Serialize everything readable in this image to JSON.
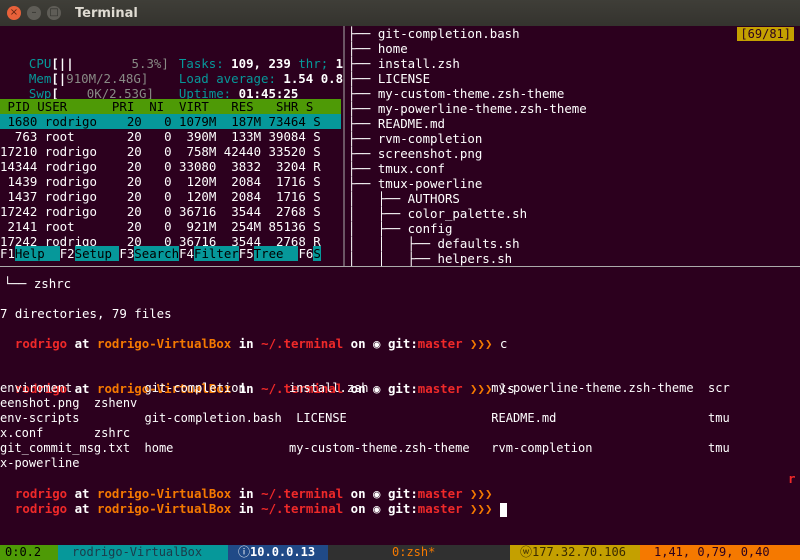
{
  "window": {
    "title": "Terminal",
    "close": "×",
    "minimize": "–",
    "maximize": "□"
  },
  "htop": {
    "cpu_label": "CPU",
    "cpu_bar": "[||",
    "cpu_value": "5.3%]",
    "mem_label": "Mem",
    "mem_bar": "[|",
    "mem_value": "910M/2.48G]",
    "swp_label": "Swp",
    "swp_bar": "[",
    "swp_value": "0K/2.53G]",
    "tasks_label": "Tasks:",
    "tasks_value": "109,",
    "thr_value": "239",
    "thr_label": "thr;",
    "running": "1",
    "load_label": "Load average:",
    "load1": "1.54",
    "load5": "0.8",
    "uptime_label": "Uptime:",
    "uptime_value": "01:45:25",
    "header": " PID USER      PRI  NI  VIRT   RES   SHR S",
    "rows": [
      " 1680 rodrigo    20   0 1079M  187M 73464 S",
      "  763 root       20   0  390M  133M 39084 S",
      "17210 rodrigo    20   0  758M 42440 33520 S",
      "14344 rodrigo    20   0 33080  3832  3204 R",
      " 1439 rodrigo    20   0  120M  2084  1716 S",
      " 1437 rodrigo    20   0  120M  2084  1716 S",
      "17242 rodrigo    20   0 36716  3544  2768 S",
      " 2141 root       20   0  921M  254M 85136 S",
      "17242 rodrigo    20   0 36716  3544  2768 R"
    ],
    "fkeys": [
      {
        "key": "F1",
        "label": "Help  "
      },
      {
        "key": "F2",
        "label": "Setup "
      },
      {
        "key": "F3",
        "label": "Search"
      },
      {
        "key": "F4",
        "label": "Filter"
      },
      {
        "key": "F5",
        "label": "Tree  "
      },
      {
        "key": "F6",
        "label": "S"
      }
    ]
  },
  "tree": {
    "counter": "[69/81]",
    "items": [
      "├── git-completion.bash",
      "├── home",
      "├── install.zsh",
      "├── LICENSE",
      "├── my-custom-theme.zsh-theme",
      "├── my-powerline-theme.zsh-theme",
      "├── README.md",
      "├── rvm-completion",
      "├── screenshot.png",
      "├── tmux.conf",
      "├── tmux-powerline",
      "│   ├── AUTHORS",
      "│   ├── color_palette.sh",
      "│   ├── config",
      "│   │   ├── defaults.sh",
      "│   │   ├── helpers.sh"
    ]
  },
  "shell": {
    "tree_last": "└── zshrc",
    "summary": "7 directories, 79 files",
    "user": "rodrigo",
    "at": " at ",
    "host": "rodrigo-VirtualBox",
    "in": " in ",
    "path": "~/.terminal",
    "on": " on ",
    "git_icon": "◉",
    "git_label": "git:",
    "branch": "master",
    "arrows": "❯❯❯",
    "cmd1": "c",
    "cmd2": "ls",
    "ls_lines": [
      "enviroment          git-completion      install.zsh                 my-powerline-theme.zsh-theme  scr",
      "eenshot.png  zshenv",
      "env-scripts         git-completion.bash  LICENSE                    README.md                     tmu",
      "x.conf       zshrc",
      "git_commit_msg.txt  home                my-custom-theme.zsh-theme   rvm-completion                tmu",
      "x-powerline"
    ],
    "right_marker": "r"
  },
  "status": {
    "session": "0:0.2",
    "host": "rodrigo-VirtualBox",
    "ip_icon": "ⓘ",
    "ip": "10.0.0.13",
    "window": "0:zsh*",
    "wan_icon": "ⓦ",
    "wan_ip": "177.32.70.106",
    "load": "1,41, 0,79, 0,40"
  },
  "colors": {
    "background": "#2c001e",
    "accent_teal": "#06989a",
    "accent_green": "#4e9a06"
  }
}
